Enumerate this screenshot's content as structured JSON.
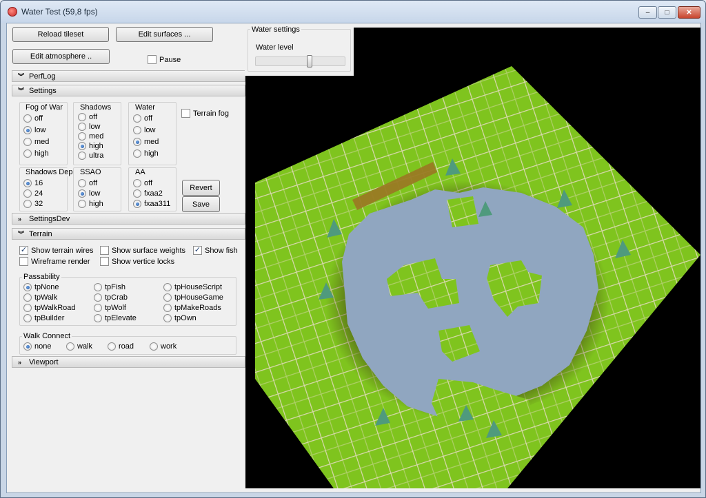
{
  "window": {
    "title": "Water Test (59,8 fps)",
    "controls": {
      "minimize": "–",
      "maximize": "□",
      "close": "✕"
    }
  },
  "toolbar": {
    "reload_tileset": "Reload tileset",
    "edit_surfaces": "Edit surfaces ...",
    "edit_atmosphere": "Edit atmosphere ..",
    "pause_label": "Pause"
  },
  "sections": {
    "perflog": "PerfLog",
    "settings": "Settings",
    "settingsdev": "SettingsDev",
    "terrain": "Terrain",
    "viewport": "Viewport"
  },
  "settings": {
    "fog_of_war": {
      "label": "Fog of War",
      "options": [
        "off",
        "low",
        "med",
        "high"
      ],
      "selected": "low"
    },
    "shadows": {
      "label": "Shadows",
      "options": [
        "off",
        "low",
        "med",
        "high",
        "ultra"
      ],
      "selected": "high"
    },
    "water": {
      "label": "Water",
      "options": [
        "off",
        "low",
        "med",
        "high"
      ],
      "selected": "med"
    },
    "terrain_fog": "Terrain fog",
    "shadows_depth": {
      "label": "Shadows Dep",
      "options": [
        "16",
        "24",
        "32"
      ],
      "selected": "16"
    },
    "ssao": {
      "label": "SSAO",
      "options": [
        "off",
        "low",
        "high"
      ],
      "selected": "low"
    },
    "aa": {
      "label": "AA",
      "options": [
        "off",
        "fxaa2",
        "fxaa311"
      ],
      "selected": "fxaa311"
    },
    "revert": "Revert",
    "save": "Save"
  },
  "terrain": {
    "show_terrain_wires": "Show terrain wires",
    "show_surface_weights": "Show surface weights",
    "show_fish": "Show fish",
    "wireframe_render": "Wireframe render",
    "show_vertice_locks": "Show vertice locks",
    "passability_label": "Passability",
    "passability": [
      "tpNone",
      "tpFish",
      "tpHouseScript",
      "tpWalk",
      "tpCrab",
      "tpHouseGame",
      "tpWalkRoad",
      "tpWolf",
      "tpMakeRoads",
      "tpBuilder",
      "tpElevate",
      "tpOwn"
    ],
    "passability_selected": "tpNone",
    "walk_connect_label": "Walk Connect",
    "walk_connect": [
      "none",
      "walk",
      "road",
      "work"
    ],
    "walk_connect_selected": "none"
  },
  "water_settings": {
    "title": "Water settings",
    "water_level_label": "Water level",
    "water_level_fraction": 0.6
  },
  "colors": {
    "grass": "#7fc41e",
    "grass_dark": "#5e9a12",
    "water": "#90a6c0",
    "shore": "#3a2a12",
    "grid": "#e8dcc8",
    "tree": "#4f9a7d",
    "crops": "#9a7a24"
  }
}
